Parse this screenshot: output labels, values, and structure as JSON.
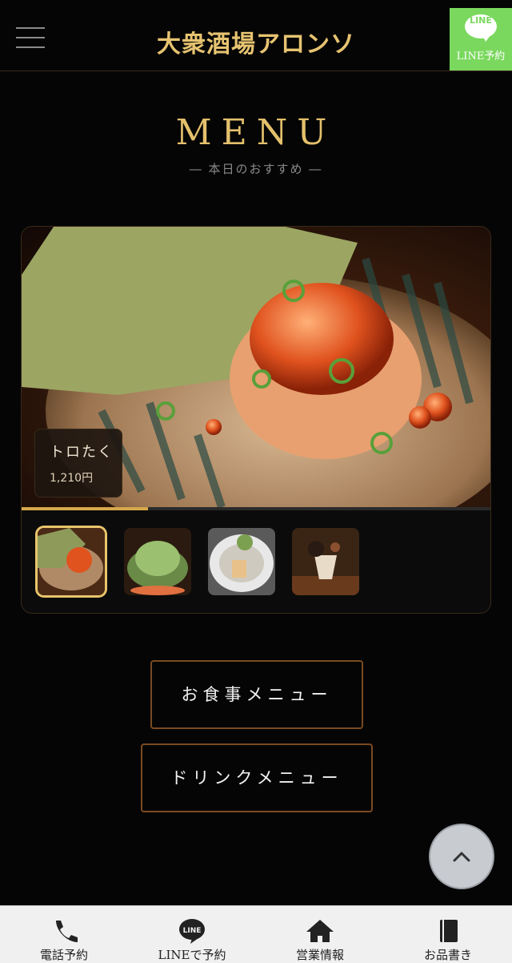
{
  "header": {
    "brand": "大衆酒場アロンソ",
    "line_badge": "LINE",
    "line_reserve_label": "LINE予約"
  },
  "section": {
    "title": "MENU",
    "subtitle": "― 本日のおすすめ ―"
  },
  "slider": {
    "current_item": {
      "name": "トロたく",
      "price": "1,210円"
    },
    "progress": 0.27,
    "thumbnails": [
      "toro-taku",
      "green-salad",
      "sashimi-plate",
      "cookie-parfait"
    ],
    "active_index": 0
  },
  "buttons": {
    "food_menu": "お食事メニュー",
    "drink_menu": "ドリンクメニュー"
  },
  "bottom_nav": {
    "items": [
      {
        "label": "電話予約",
        "icon": "phone-icon"
      },
      {
        "label": "LINEで予約",
        "icon": "line-icon"
      },
      {
        "label": "営業情報",
        "icon": "home-icon"
      },
      {
        "label": "お品書き",
        "icon": "book-icon"
      }
    ]
  },
  "colors": {
    "accent_gold": "#e4c06c",
    "line_green": "#7bd85f",
    "border_brown": "#7a4a22"
  }
}
